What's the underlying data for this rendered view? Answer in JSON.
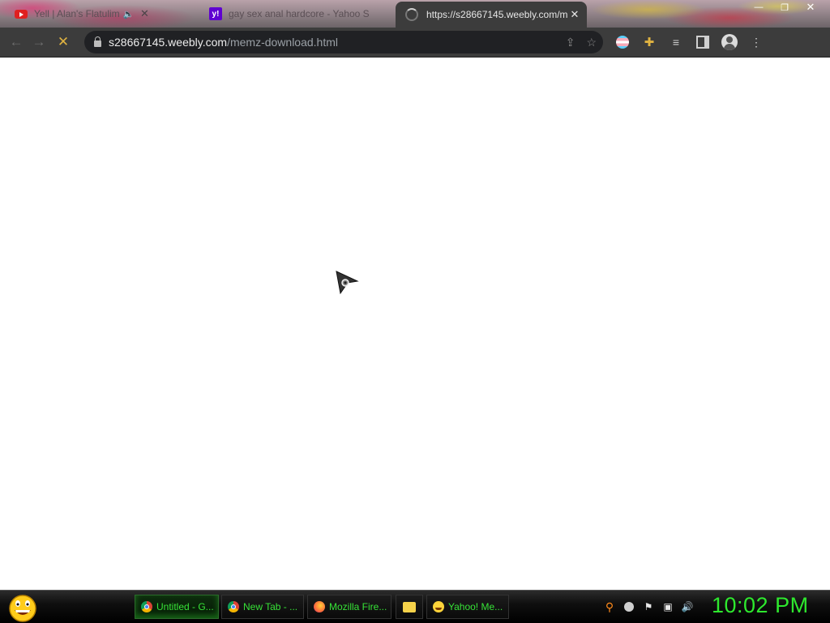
{
  "browser": {
    "tabs": [
      {
        "title": "Yell | Alan's Flatulim",
        "icon": "youtube-icon",
        "audio": true
      },
      {
        "title": "gay sex anal hardcore - Yahoo S",
        "icon": "yahoo-icon"
      },
      {
        "title": "https://s28667145.weebly.com/m",
        "icon": "loading-spinner-icon",
        "active": true
      }
    ],
    "window_controls": {
      "minimize": "—",
      "maximize": "❐",
      "close": "✕"
    },
    "address": {
      "host": "s28667145.weebly.com",
      "path": "/memz-download.html"
    },
    "toolbar_icons": [
      "share-icon",
      "bookmark-star-icon",
      "extension-flag-icon",
      "extensions-puzzle-icon",
      "media-queue-icon",
      "side-panel-icon",
      "profile-icon",
      "menu-icon"
    ]
  },
  "taskbar": {
    "buttons": [
      {
        "label": "Untitled - G...",
        "icon": "chrome-icon",
        "active": true
      },
      {
        "label": "New Tab - ...",
        "icon": "chrome-icon"
      },
      {
        "label": "Mozilla Fire...",
        "icon": "firefox-icon"
      },
      {
        "label": "",
        "icon": "folder-icon"
      },
      {
        "label": "Yahoo! Me...",
        "icon": "yahoo-messenger-icon"
      }
    ],
    "clock": "10:02 PM",
    "colors": {
      "text": "#37e337",
      "clock": "#2ee82e"
    }
  }
}
